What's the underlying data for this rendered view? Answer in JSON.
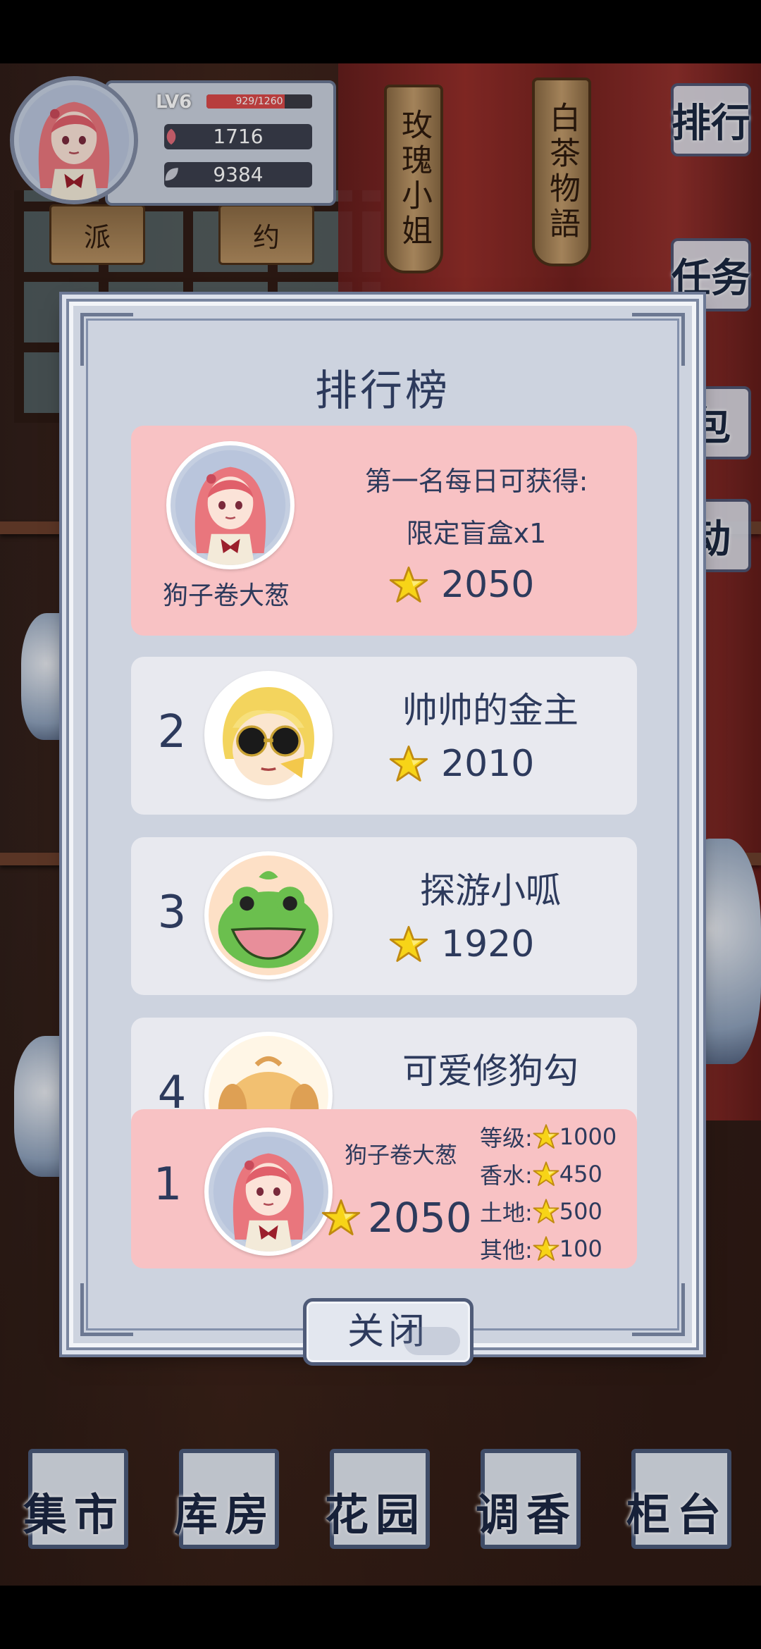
{
  "player": {
    "level": "LV6",
    "xp_text": "929/1260",
    "xp_fraction": 0.737,
    "resource_1": "1716",
    "resource_2": "9384"
  },
  "scene_signs": {
    "sign_1": "玫瑰小姐",
    "sign_2": "白茶物語",
    "small_1": "派",
    "small_2": "约"
  },
  "side_menu": {
    "items": [
      {
        "label": "排行"
      },
      {
        "label": "任务"
      },
      {
        "label": "包"
      },
      {
        "label": "动"
      }
    ]
  },
  "bottom_nav": {
    "items": [
      {
        "label": "集市"
      },
      {
        "label": "库房"
      },
      {
        "label": "花园"
      },
      {
        "label": "调香"
      },
      {
        "label": "柜台"
      }
    ]
  },
  "leaderboard": {
    "title": "排行榜",
    "top": {
      "name": "狗子卷大葱",
      "reward_line_1": "第一名每日可获得:",
      "reward_line_2": "限定盲盒x1",
      "score": "2050"
    },
    "entries": [
      {
        "rank": "2",
        "name": "帅帅的金主",
        "score": "2010",
        "avatar": "sunglasses-guy-avatar"
      },
      {
        "rank": "3",
        "name": "探游小呱",
        "score": "1920",
        "avatar": "frog-avatar"
      },
      {
        "rank": "4",
        "name": "可爱修狗勾",
        "score": "",
        "avatar": "dog-avatar"
      }
    ],
    "me": {
      "rank": "1",
      "name": "狗子卷大葱",
      "total": "2050",
      "breakdown": [
        {
          "label": "等级:",
          "value": "1000"
        },
        {
          "label": "香水:",
          "value": "450"
        },
        {
          "label": "土地:",
          "value": "500"
        },
        {
          "label": "其他:",
          "value": "100"
        }
      ]
    },
    "close_label": "关闭"
  }
}
